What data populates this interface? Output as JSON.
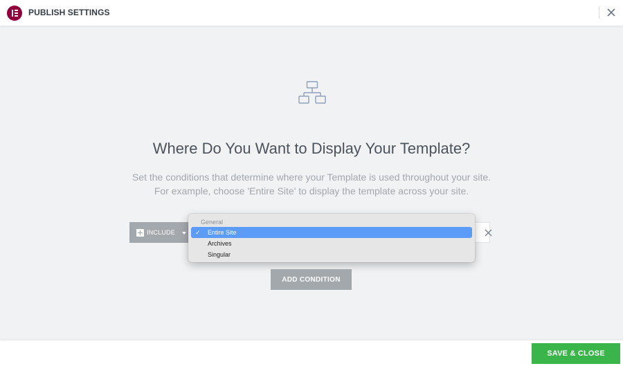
{
  "header": {
    "title": "PUBLISH SETTINGS",
    "logo_icon": "elementor-logo-icon",
    "close_icon": "close-icon"
  },
  "main": {
    "icon": "sitemap-icon",
    "title": "Where Do You Want to Display Your Template?",
    "description_line1": "Set the conditions that determine where your Template is used throughout your site.",
    "description_line2": "For example, choose 'Entire Site' to display the template across your site."
  },
  "condition": {
    "include_label": "INCLUDE",
    "dropdown": {
      "group_label": "General",
      "options": [
        {
          "label": "Entire Site",
          "selected": true
        },
        {
          "label": "Archives",
          "selected": false
        },
        {
          "label": "Singular",
          "selected": false
        }
      ],
      "check_mark": "✓"
    }
  },
  "add_condition_label": "ADD CONDITION",
  "footer": {
    "save_label": "SAVE & CLOSE"
  },
  "colors": {
    "brand": "#92003b",
    "save_green": "#39b54a",
    "selection_blue": "#5a9cf8",
    "gray_button": "#a3a8ad"
  }
}
